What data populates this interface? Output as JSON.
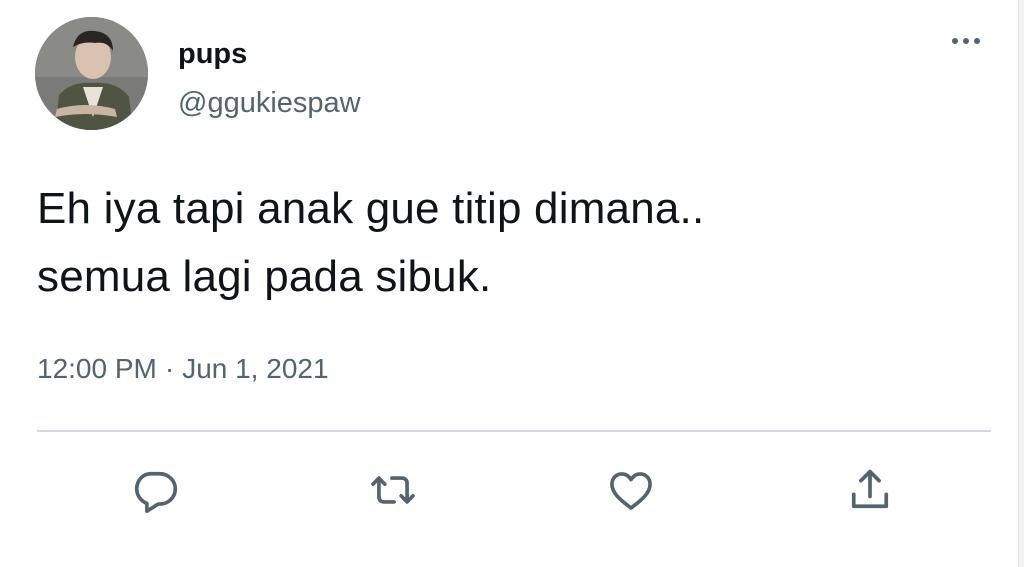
{
  "author": {
    "display_name": "pups",
    "handle": "@ggukiespaw",
    "avatar_icon": "profile-photo"
  },
  "tweet": {
    "lines": [
      "Eh iya tapi anak gue titip dimana..",
      "semua lagi pada sibuk."
    ],
    "time": "12:00 PM",
    "separator": "·",
    "date": "Jun 1, 2021"
  },
  "actions": {
    "reply_icon": "reply-icon",
    "retweet_icon": "retweet-icon",
    "like_icon": "heart-icon",
    "share_icon": "share-icon"
  },
  "colors": {
    "text": "#0f1419",
    "secondary": "#536471",
    "divider": "#cfd9de"
  }
}
